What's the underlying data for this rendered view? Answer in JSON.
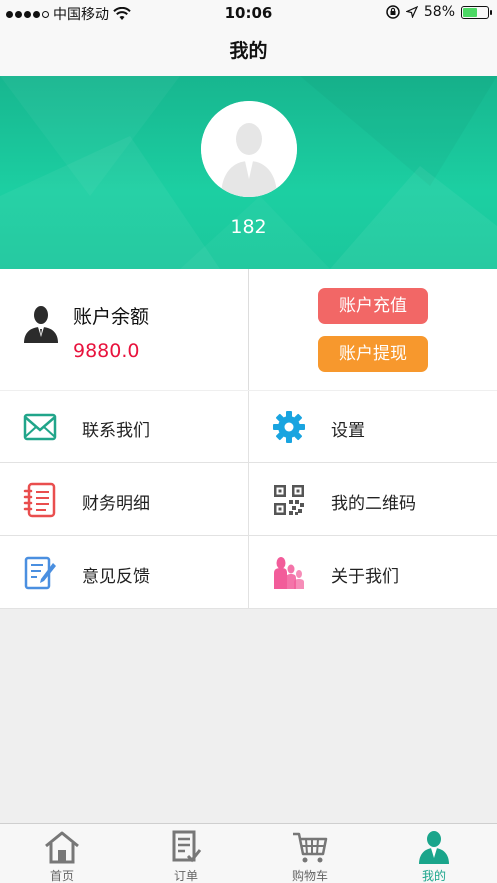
{
  "status_bar": {
    "carrier": "中国移动",
    "time": "10:06",
    "battery": "58%",
    "battery_level": 0.58
  },
  "nav": {
    "title": "我的"
  },
  "profile": {
    "name": "182"
  },
  "balance": {
    "label": "账户余额",
    "amount": "9880.0",
    "recharge_label": "账户充值",
    "withdraw_label": "账户提现"
  },
  "menu": {
    "items": [
      {
        "label": "联系我们",
        "icon": "envelope-icon"
      },
      {
        "label": "设置",
        "icon": "gear-icon"
      },
      {
        "label": "财务明细",
        "icon": "notebook-icon"
      },
      {
        "label": "我的二维码",
        "icon": "qr-code-icon"
      },
      {
        "label": "意见反馈",
        "icon": "feedback-icon"
      },
      {
        "label": "关于我们",
        "icon": "people-icon"
      }
    ]
  },
  "tabs": [
    {
      "label": "首页",
      "icon": "home-icon"
    },
    {
      "label": "订单",
      "icon": "order-icon"
    },
    {
      "label": "购物车",
      "icon": "cart-icon"
    },
    {
      "label": "我的",
      "icon": "profile-icon",
      "active": true
    }
  ],
  "colors": {
    "accent": "#1ccfa2",
    "amount": "#e8133d",
    "recharge": "#f26766",
    "withdraw": "#f7982d"
  }
}
